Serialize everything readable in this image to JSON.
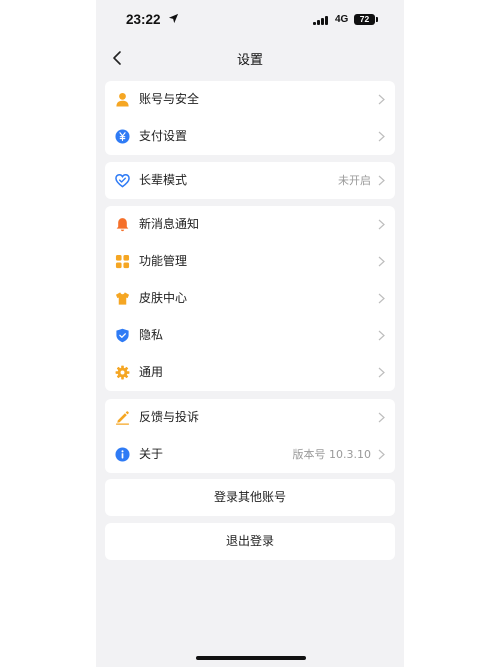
{
  "status_bar": {
    "time": "23:22",
    "network": "4G",
    "battery": "72"
  },
  "header": {
    "title": "设置"
  },
  "groups": [
    [
      {
        "label": "账号与安全",
        "icon": "user-icon",
        "color": "#f5a623"
      },
      {
        "label": "支付设置",
        "icon": "yuan-icon",
        "color": "#2f7bf5"
      }
    ],
    [
      {
        "label": "长辈模式",
        "value": "未开启",
        "icon": "heart-icon",
        "color": "#2f7bf5"
      }
    ],
    [
      {
        "label": "新消息通知",
        "icon": "bell-icon",
        "color": "#f5702a"
      },
      {
        "label": "功能管理",
        "icon": "grid-icon",
        "color": "#f5a623"
      },
      {
        "label": "皮肤中心",
        "icon": "shirt-icon",
        "color": "#f5a623"
      },
      {
        "label": "隐私",
        "icon": "shield-icon",
        "color": "#2f7bf5"
      },
      {
        "label": "通用",
        "icon": "gear-icon",
        "color": "#f5a623"
      }
    ],
    [
      {
        "label": "反馈与投诉",
        "icon": "pencil-icon",
        "color": "#f5a623"
      },
      {
        "label": "关于",
        "value": "版本号 10.3.10",
        "icon": "info-icon",
        "color": "#2f7bf5"
      }
    ]
  ],
  "actions": {
    "switch_account": "登录其他账号",
    "logout": "退出登录"
  }
}
